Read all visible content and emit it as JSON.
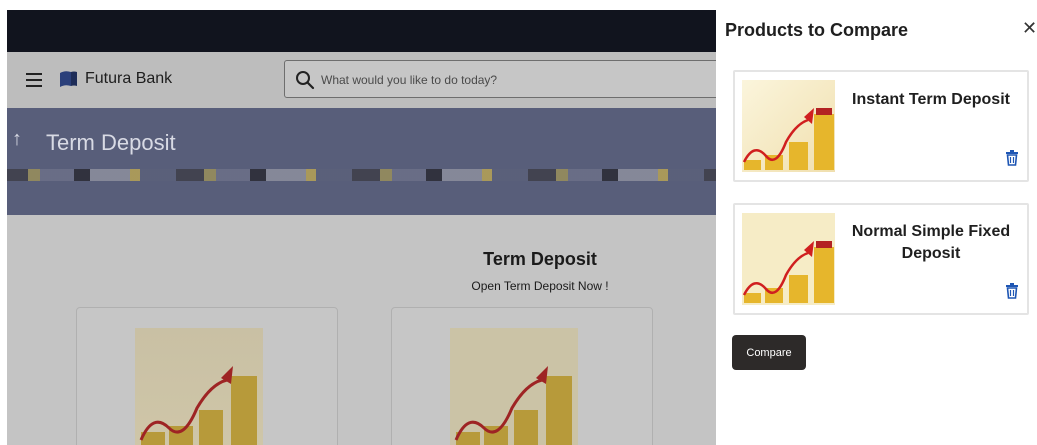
{
  "header": {
    "brand": "Futura Bank",
    "search": {
      "placeholder": "What would you like to do today?",
      "value": ""
    }
  },
  "banner": {
    "title": "Term Deposit"
  },
  "content": {
    "title": "Term Deposit",
    "subtitle": "Open Term Deposit Now !"
  },
  "compare_panel": {
    "title": "Products to Compare",
    "products": [
      {
        "name": "Instant Term Deposit"
      },
      {
        "name": "Normal Simple Fixed Deposit"
      }
    ],
    "compare_label": "Compare"
  },
  "colors": {
    "topbar": "#11141e",
    "banner": "#585e7a",
    "compare_button": "#2d2a29",
    "trash_icon": "#1e56b4",
    "growth_arrow": "#d01f1f",
    "coin_gold": "#e6b62c"
  },
  "icons": [
    "hamburger-icon",
    "bank-logo-icon",
    "search-icon",
    "back-arrow-icon",
    "close-icon",
    "trash-icon"
  ]
}
